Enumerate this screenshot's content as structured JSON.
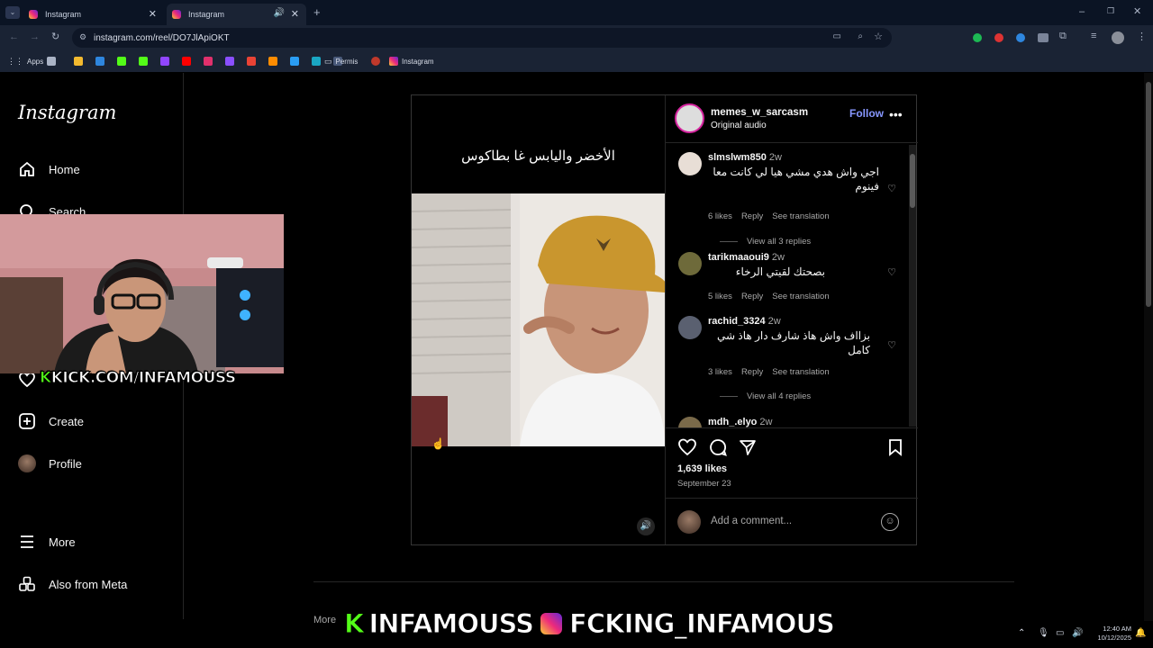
{
  "browser": {
    "tabs": [
      {
        "title": "Instagram",
        "active": false
      },
      {
        "title": "Instagram",
        "active": true
      }
    ],
    "url": "instagram.com/reel/DO7JlApiOKT",
    "bookmarks": [
      "Apps",
      "Permis",
      "Instagram"
    ]
  },
  "sidebar": {
    "logo": "Instagram",
    "items": [
      {
        "label": "Home",
        "icon": "home-icon"
      },
      {
        "label": "Search",
        "icon": "search-icon"
      },
      {
        "label": "Create",
        "icon": "create-icon"
      },
      {
        "label": "Profile",
        "icon": "profile-avatar"
      },
      {
        "label": "More",
        "icon": "menu-icon"
      },
      {
        "label": "Also from Meta",
        "icon": "meta-icon"
      }
    ]
  },
  "post": {
    "caption_overlay": "الأخضر واليابس غا بطاكوس",
    "author": "memes_w_sarcasm",
    "follow": "Follow",
    "audio": "Original audio",
    "likes": "1,639 likes",
    "date": "September 23",
    "add_comment_placeholder": "Add a comment..."
  },
  "comments": [
    {
      "user": "slmslwm850",
      "age": "2w",
      "text": "اجي واش هدي مشي هيا لي كانت معا فينوم",
      "likes": "6 likes",
      "reply": "Reply",
      "translate": "See translation",
      "view_replies": "View all 3 replies"
    },
    {
      "user": "tarikmaaoui9",
      "age": "2w",
      "text": "بصحتك لقيتي الرخاء",
      "likes": "5 likes",
      "reply": "Reply",
      "translate": "See translation"
    },
    {
      "user": "rachid_3324",
      "age": "2w",
      "text": "بزااف واش هاذ شارف دار هاذ شي كامل",
      "likes": "3 likes",
      "reply": "Reply",
      "translate": "See translation",
      "view_replies": "View all 4 replies"
    },
    {
      "user": "mdh_.elyo",
      "age": "2w"
    }
  ],
  "overlays": {
    "kick_small": "KICK.COM/INFAMOUSS",
    "bottom_kick": "INFAMOUSS",
    "bottom_insta": "FCKING_INFAMOUS",
    "more_partial": "More"
  },
  "taskbar": {
    "time": "12:40 AM",
    "date": "10/12/2025"
  },
  "colors": {
    "accent": "#8797ff",
    "bg": "#000000",
    "kick_green": "#53fc18"
  }
}
